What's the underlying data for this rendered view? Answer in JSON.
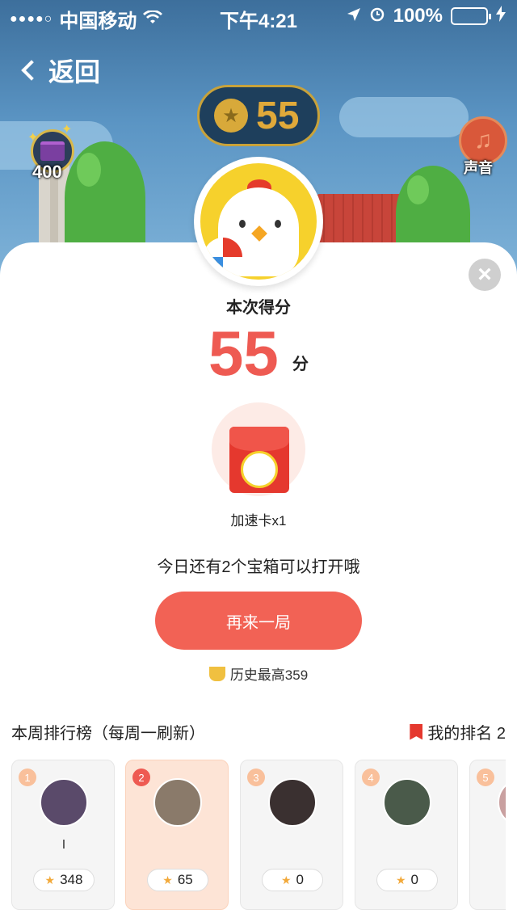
{
  "status": {
    "carrier": "中国移动",
    "time": "下午4:21",
    "battery": "100%"
  },
  "nav": {
    "back_label": "返回"
  },
  "top": {
    "coin_score": "55",
    "gift_count": "400",
    "sound_label": "声音"
  },
  "result": {
    "score_label": "本次得分",
    "score": "55",
    "unit": "分",
    "reward_label": "加速卡x1",
    "chest_msg": "今日还有2个宝箱可以打开哦",
    "again_button": "再来一局",
    "best_label": "历史最高359"
  },
  "ranking": {
    "title": "本周排行榜（每周一刷新）",
    "my_rank_label": "我的排名 2",
    "entries": [
      {
        "rank": "1",
        "name": "I",
        "score": "348"
      },
      {
        "rank": "2",
        "name": "",
        "score": "65"
      },
      {
        "rank": "3",
        "name": "",
        "score": "0"
      },
      {
        "rank": "4",
        "name": "",
        "score": "0"
      },
      {
        "rank": "5",
        "name": "",
        "score": ""
      }
    ]
  }
}
